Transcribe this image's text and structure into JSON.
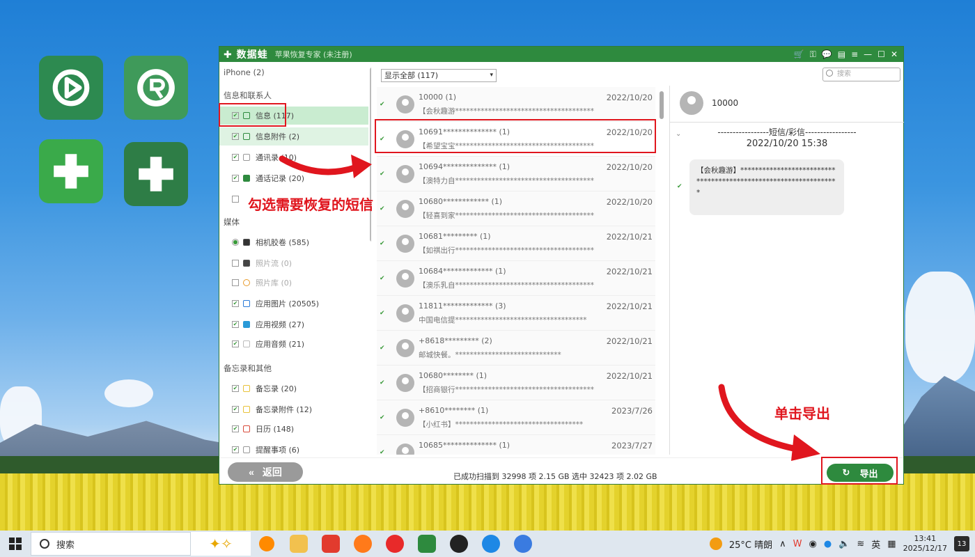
{
  "app": {
    "logo": "✚ 数据蛙",
    "subtitle": "苹果恢复专家 (未注册)",
    "brand_color": "#2e8a3e"
  },
  "sidebar": {
    "device": "iPhone (2)",
    "sections": [
      {
        "title": "信息和联系人",
        "items": [
          {
            "label": "信息 (117)",
            "checked": true
          },
          {
            "label": "信息附件 (2)",
            "checked": true
          },
          {
            "label": "通讯录 (10)",
            "checked": true
          },
          {
            "label": "通话记录 (20)",
            "checked": true
          },
          {
            "label": "",
            "checked": false
          }
        ]
      },
      {
        "title": "媒体",
        "items": [
          {
            "label": "相机胶卷 (585)",
            "checked": true
          },
          {
            "label": "照片流 (0)",
            "checked": false
          },
          {
            "label": "照片库 (0)",
            "checked": false
          },
          {
            "label": "应用图片 (20505)",
            "checked": true
          },
          {
            "label": "应用视频 (27)",
            "checked": true
          },
          {
            "label": "应用音频 (21)",
            "checked": true
          }
        ]
      },
      {
        "title": "备忘录和其他",
        "items": [
          {
            "label": "备忘录 (20)",
            "checked": true
          },
          {
            "label": "备忘录附件 (12)",
            "checked": true
          },
          {
            "label": "日历 (148)",
            "checked": true
          },
          {
            "label": "提醒事项 (6)",
            "checked": true
          }
        ]
      }
    ]
  },
  "filter": {
    "selected": "显示全部 (117)"
  },
  "search": {
    "placeholder": "搜索"
  },
  "messages": [
    {
      "name": "10000 (1)",
      "date": "2022/10/20",
      "preview": "【会秋趣游**************************************"
    },
    {
      "name": "10691************** (1)",
      "date": "2022/10/20",
      "preview": "【希望宝宝**************************************"
    },
    {
      "name": "10694************** (1)",
      "date": "2022/10/20",
      "preview": "【澳特力自**************************************"
    },
    {
      "name": "10680************ (1)",
      "date": "2022/10/20",
      "preview": "【轻喜到家**************************************"
    },
    {
      "name": "10681********* (1)",
      "date": "2022/10/21",
      "preview": "【如祺出行**************************************"
    },
    {
      "name": "10684************* (1)",
      "date": "2022/10/21",
      "preview": "【澳乐乳自**************************************"
    },
    {
      "name": "11811************* (3)",
      "date": "2022/10/21",
      "preview": "中国电信提************************************"
    },
    {
      "name": "+8618********* (2)",
      "date": "2022/10/21",
      "preview": "邮城快餐。*****************************"
    },
    {
      "name": "10680******** (1)",
      "date": "2022/10/21",
      "preview": "【招商银行**************************************"
    },
    {
      "name": "+8610******** (1)",
      "date": "2023/7/26",
      "preview": "【小红书】***********************************"
    },
    {
      "name": "10685************** (1)",
      "date": "2023/7/27",
      "preview": ""
    }
  ],
  "detail": {
    "name": "10000",
    "type": "-----------------短信/彩信-----------------",
    "time": "2022/10/20 15:38",
    "body": "【会秋趣游】*****************************************************************"
  },
  "footer": {
    "back": "返回",
    "status": "已成功扫描到 32998 项 2.15 GB  选中 32423 项 2.02 GB",
    "export": "导出"
  },
  "annotations": {
    "check": "勾选需要恢复的短信",
    "click": "单击导出",
    "color": "#e0161e"
  },
  "taskbar": {
    "search": "搜索",
    "weather": "25°C 晴朗",
    "ime": "英",
    "time": "13:41",
    "date": "2025/12/17",
    "notifications": "13"
  }
}
